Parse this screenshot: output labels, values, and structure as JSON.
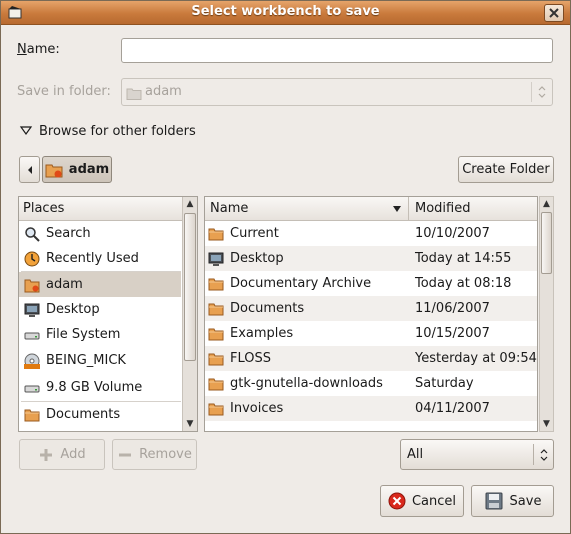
{
  "window": {
    "title": "Select workbench to save"
  },
  "name_field": {
    "label": "Name:",
    "value": ""
  },
  "save_in": {
    "label": "Save in folder:",
    "value": "adam"
  },
  "browse": {
    "label": "Browse for other folders"
  },
  "path_bar": {
    "current": "adam"
  },
  "create_folder": {
    "label": "Create Folder"
  },
  "places": {
    "header": "Places",
    "items": [
      {
        "label": "Search",
        "icon": "search-icon"
      },
      {
        "label": "Recently Used",
        "icon": "clock-icon"
      },
      {
        "label": "adam",
        "icon": "home-folder-icon"
      },
      {
        "label": "Desktop",
        "icon": "desktop-icon"
      },
      {
        "label": "File System",
        "icon": "drive-icon"
      },
      {
        "label": "BEING_MICK",
        "icon": "cdrom-icon"
      },
      {
        "label": "9.8 GB Volume",
        "icon": "drive-icon"
      },
      {
        "label": "Documents",
        "icon": "folder-icon"
      }
    ]
  },
  "files": {
    "col_name": "Name",
    "col_modified": "Modified",
    "rows": [
      {
        "name": "Current",
        "modified": "10/10/2007",
        "icon": "folder-icon"
      },
      {
        "name": "Desktop",
        "modified": "Today at 14:55",
        "icon": "desktop-icon"
      },
      {
        "name": "Documentary Archive",
        "modified": "Today at 08:18",
        "icon": "folder-icon"
      },
      {
        "name": "Documents",
        "modified": "11/06/2007",
        "icon": "folder-icon"
      },
      {
        "name": "Examples",
        "modified": "10/15/2007",
        "icon": "folder-icon"
      },
      {
        "name": "FLOSS",
        "modified": "Yesterday at 09:54",
        "icon": "folder-icon"
      },
      {
        "name": "gtk-gnutella-downloads",
        "modified": "Saturday",
        "icon": "folder-icon"
      },
      {
        "name": "Invoices",
        "modified": "04/11/2007",
        "icon": "folder-icon"
      }
    ]
  },
  "add_button": {
    "label": "Add"
  },
  "remove_button": {
    "label": "Remove"
  },
  "filter": {
    "value": "All"
  },
  "cancel_button": {
    "label": "Cancel"
  },
  "save_button": {
    "label": "Save"
  },
  "colors": {
    "titlebar": "#c97a3c",
    "background": "#efebe7",
    "selection": "#d8d0c6",
    "folder": "#e8a050"
  }
}
